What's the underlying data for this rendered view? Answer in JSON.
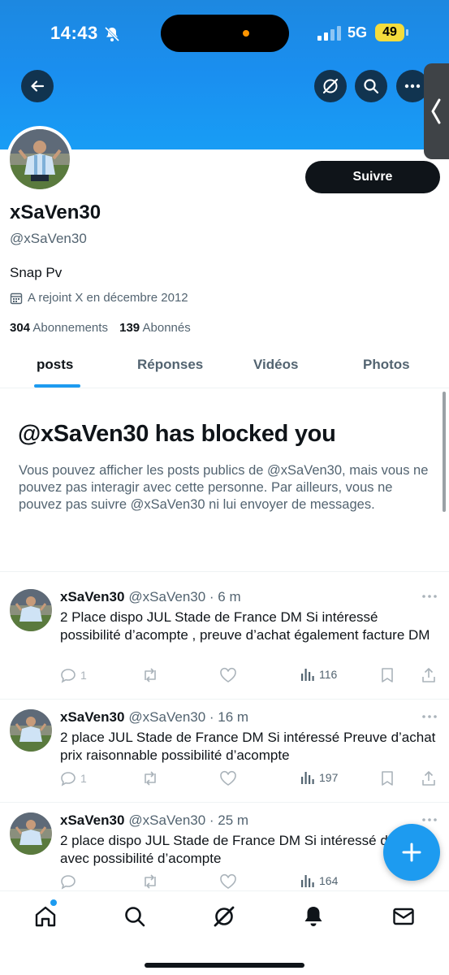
{
  "status_bar": {
    "time": "14:43",
    "network": "5G",
    "battery": "49"
  },
  "header": {
    "back_icon": "back-arrow-icon",
    "grok_icon": "grok-icon",
    "search_icon": "search-icon",
    "more_icon": "more-icon"
  },
  "profile": {
    "name": "xSaVen30",
    "handle": "@xSaVen30",
    "bio": "Snap Pv",
    "joined": "A rejoint X en décembre 2012",
    "following_count": "304",
    "following_label": "Abonnements",
    "followers_count": "139",
    "followers_label": "Abonnés",
    "follow_button": "Suivre"
  },
  "tabs": [
    {
      "label": "posts",
      "active": true
    },
    {
      "label": "Réponses",
      "active": false
    },
    {
      "label": "Vidéos",
      "active": false
    },
    {
      "label": "Photos",
      "active": false
    }
  ],
  "blocked": {
    "title": "@xSaVen30 has blocked you",
    "text": "Vous pouvez afficher les posts publics de @xSaVen30, mais vous ne pouvez pas interagir avec cette personne. Par ailleurs, vous ne pouvez pas suivre @xSaVen30 ni lui envoyer de messages."
  },
  "posts": [
    {
      "name": "xSaVen30",
      "meta": "@xSaVen30 · 6 m",
      "text": "2 Place dispo JUL Stade de France DM Si intéressé possibilité d’acompte , preuve d’achat également facture DM",
      "replies": "1",
      "views": "116"
    },
    {
      "name": "xSaVen30",
      "meta": "@xSaVen30 · 16 m",
      "text": "2 place JUL Stade de France DM Si intéressé Preuve d’achat prix raisonnable possibilité d’acompte",
      "replies": "1",
      "views": "197"
    },
    {
      "name": "xSaVen30",
      "meta": "@xSaVen30 · 25 m",
      "text": "2 place dispo JUL Stade de France DM Si intéressé d’achat avec possibilité d’acompte",
      "replies": "",
      "views": "164"
    }
  ],
  "colors": {
    "accent": "#1d9bf0",
    "text": "#0f1419",
    "muted": "#536471",
    "banner": "#1a8ff0"
  }
}
